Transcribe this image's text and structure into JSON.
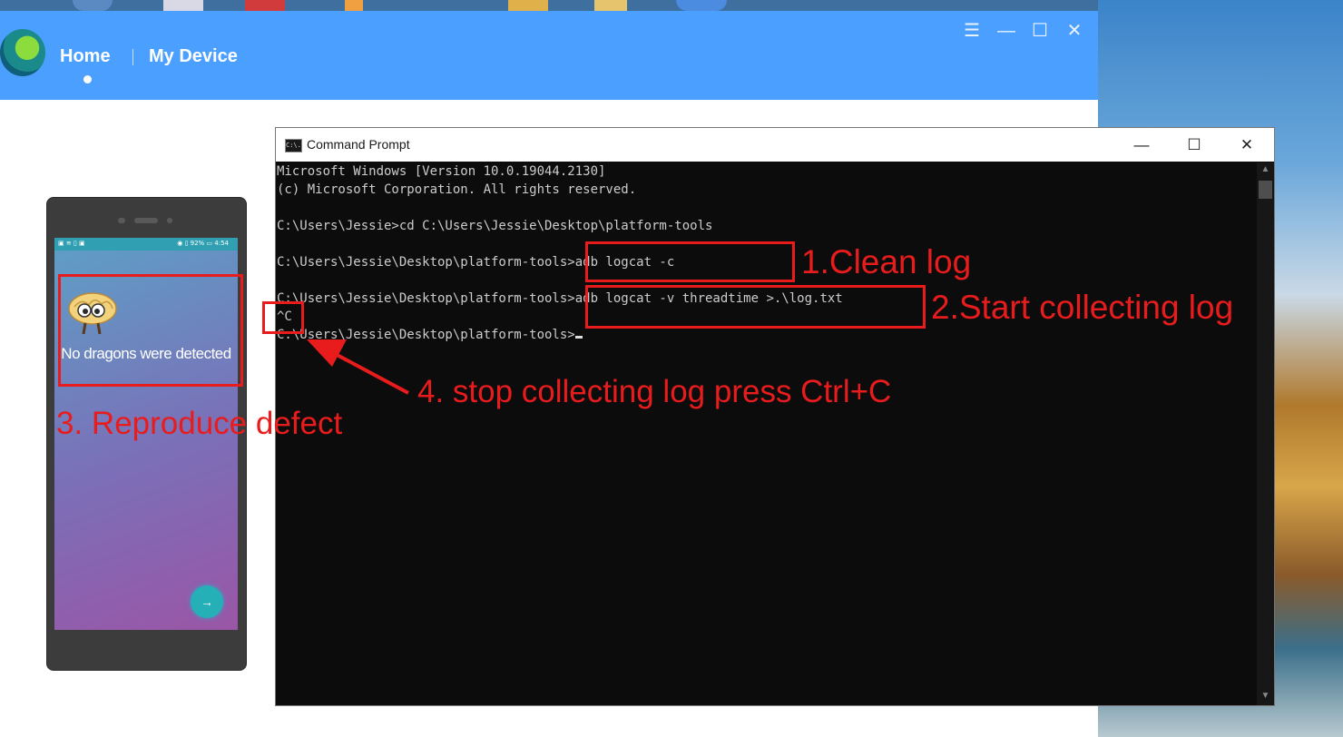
{
  "app": {
    "nav": {
      "home": "Home",
      "device": "My Device"
    },
    "window_controls": {
      "menu": "☰",
      "minimize": "—",
      "maximize": "☐",
      "close": "✕"
    }
  },
  "phone": {
    "status_left": "▣ ≋ ▯ ▣",
    "status_right": "◉ ▯ 92% ▭ 4:54",
    "message": "No dragons were detected",
    "fab_symbol": "→"
  },
  "cmd": {
    "title": "Command Prompt",
    "icon_text": "C:\\.",
    "controls": {
      "minimize": "—",
      "maximize": "☐",
      "close": "✕"
    },
    "lines": [
      "Microsoft Windows [Version 10.0.19044.2130]",
      "(c) Microsoft Corporation. All rights reserved.",
      "",
      "C:\\Users\\Jessie>cd C:\\Users\\Jessie\\Desktop\\platform-tools",
      "",
      "C:\\Users\\Jessie\\Desktop\\platform-tools>adb logcat -c",
      "",
      "C:\\Users\\Jessie\\Desktop\\platform-tools>adb logcat -v threadtime >.\\log.txt",
      "^C",
      "C:\\Users\\Jessie\\Desktop\\platform-tools>"
    ]
  },
  "annotations": {
    "step1": "1.Clean log",
    "step2": "2.Start collecting log",
    "step3": "3. Reproduce defect",
    "step4": "4. stop collecting log press Ctrl+C"
  },
  "colors": {
    "accent": "#4ba0ff",
    "annotation": "#e81c1c",
    "terminal_bg": "#0c0c0c"
  }
}
